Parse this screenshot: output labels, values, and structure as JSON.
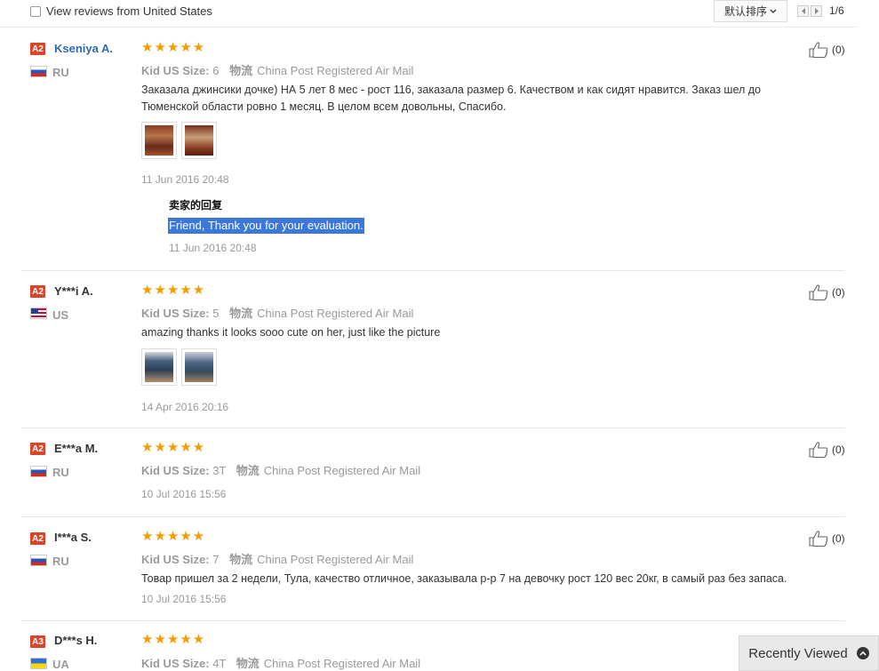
{
  "header": {
    "filter_label": "View reviews from United States",
    "sort_label": "默认排序",
    "page_indicator": "1/6"
  },
  "reviews": [
    {
      "badge": "A2",
      "name": "Kseniya A.",
      "country": "RU",
      "rating": 5,
      "size_label": "Kid US Size:",
      "size": "6",
      "logistics_label": "物流",
      "logistics": "China Post Registered Air Mail",
      "text": "Заказала джинсики дочке) НА 5 лет 8 мес - рост 116, заказала размер 6. Качеством и как сидят нравится. Заказ шел до Тюменской области ровно 1 месяц. В целом всем довольны, Спасибо.",
      "date": "11 Jun 2016 20:48",
      "likes": "(0)",
      "reply": {
        "title": "卖家的回复",
        "text": "Friend, Thank you for your evaluation.",
        "date": "11 Jun 2016 20:48"
      }
    },
    {
      "badge": "A2",
      "name": "Y***i A.",
      "country": "US",
      "rating": 5,
      "size_label": "Kid US Size:",
      "size": "5",
      "logistics_label": "物流",
      "logistics": "China Post Registered Air Mail",
      "text": "amazing thanks it looks sooo cute on her, just like the picture",
      "date": "14 Apr 2016 20:16",
      "likes": "(0)"
    },
    {
      "badge": "A2",
      "name": "E***a M.",
      "country": "RU",
      "rating": 5,
      "size_label": "Kid US Size:",
      "size": "3T",
      "logistics_label": "物流",
      "logistics": "China Post Registered Air Mail",
      "date": "10 Jul 2016 15:56",
      "likes": "(0)"
    },
    {
      "badge": "A2",
      "name": "I***a S.",
      "country": "RU",
      "rating": 5,
      "size_label": "Kid US Size:",
      "size": "7",
      "logistics_label": "物流",
      "logistics": "China Post Registered Air Mail",
      "text": "Товар пришел за 2 недели, Тула, качество отличное, заказывала р-р 7 на девочку рост 120 вес 20кг, в самый раз без запаса.",
      "date": "10 Jul 2016 15:56",
      "likes": "(0)"
    },
    {
      "badge": "A3",
      "name": "D***s H.",
      "country": "UA",
      "rating": 5,
      "size_label": "Kid US Size:",
      "size": "4T",
      "logistics_label": "物流",
      "logistics": "China Post Registered Air Mail"
    }
  ],
  "stars_text": "★★★★★",
  "recently_viewed": "Recently Viewed",
  "colors": {
    "badge": "#d9452a",
    "stars": "#f59c00",
    "link": "#2b6cb0",
    "selection": "#3b78d8"
  }
}
